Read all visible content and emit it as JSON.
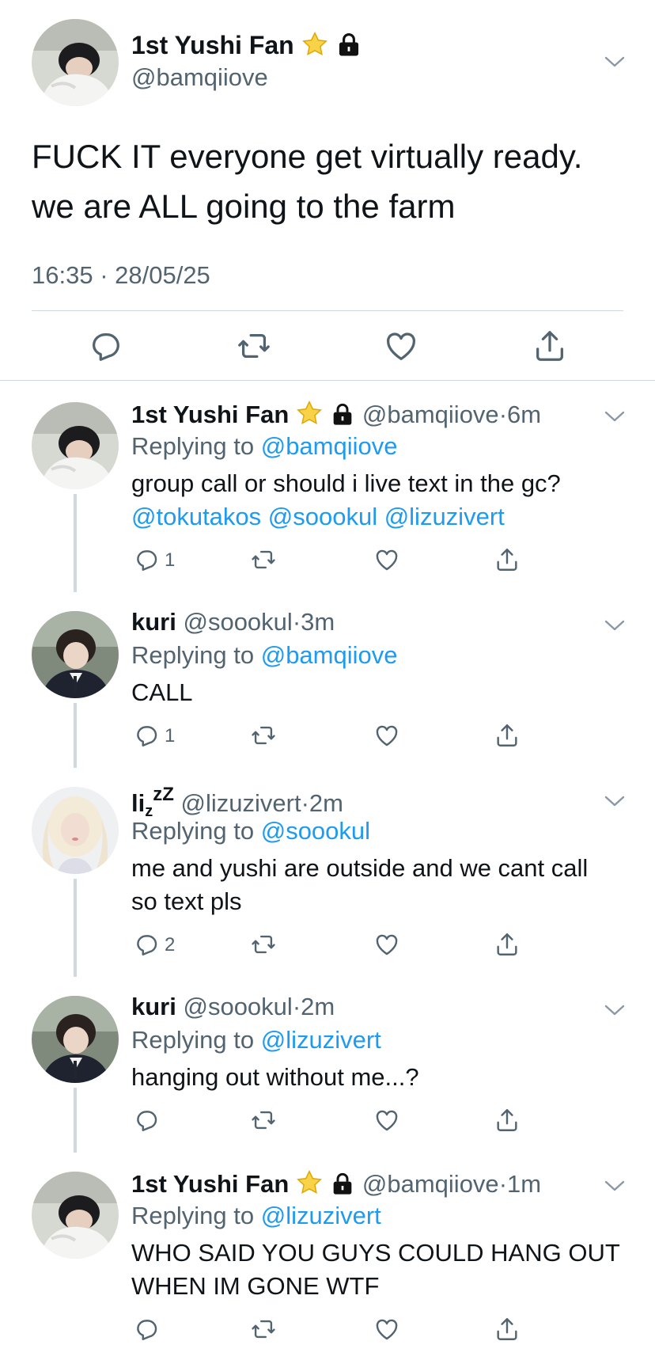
{
  "main_tweet": {
    "display_name": "1st Yushi Fan",
    "handle": "@bamqiiove",
    "text": "FUCK IT everyone get virtually ready.\nwe are ALL going to the farm",
    "timestamp": "16:35 · 28/05/25",
    "icons": [
      "star-icon",
      "lock-icon",
      "chevron-down-icon",
      "reply-icon",
      "retweet-icon",
      "like-icon",
      "share-icon"
    ]
  },
  "replies": [
    {
      "display_name": "1st Yushi Fan",
      "handle": "@bamqiiove",
      "time": "6m",
      "replying_label": "Replying to",
      "replying_to": "@bamqiiove",
      "text": "group call or should i live text in the gc?",
      "mentions": "@tokutakos @soookul @lizuzivert",
      "reply_count": "1"
    },
    {
      "display_name": "kuri",
      "handle": "@soookul",
      "time": "3m",
      "replying_label": "Replying to",
      "replying_to": "@bamqiiove",
      "text": "CALL",
      "reply_count": "1"
    },
    {
      "display_name": "li",
      "display_name_sub": "z",
      "display_name_sup": "z",
      "display_name_sup2": "Z",
      "handle": "@lizuzivert",
      "time": "2m",
      "replying_label": "Replying to",
      "replying_to": "@soookul",
      "text": "me and yushi are outside and we cant call\nso text pls",
      "reply_count": "2"
    },
    {
      "display_name": "kuri",
      "handle": "@soookul",
      "time": "2m",
      "replying_label": "Replying to",
      "replying_to": "@lizuzivert",
      "text": "hanging out without me...?",
      "reply_count": ""
    },
    {
      "display_name": "1st Yushi Fan",
      "handle": "@bamqiiove",
      "time": "1m",
      "replying_label": "Replying to",
      "replying_to": "@lizuzivert",
      "text": "WHO SAID YOU GUYS COULD HANG OUT\nWHEN IM GONE WTF",
      "reply_count": ""
    }
  ],
  "colors": {
    "text": "#0f1419",
    "secondary": "#536471",
    "link": "#1d9bf0",
    "divider": "#cfd9de",
    "star": "#f5c518"
  }
}
